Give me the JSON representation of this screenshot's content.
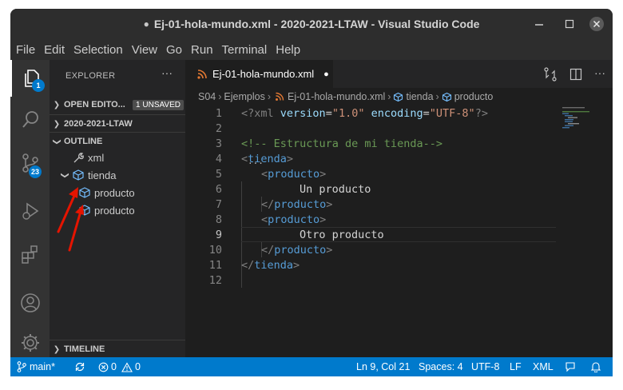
{
  "titlebar": {
    "title": "Ej-01-hola-mundo.xml - 2020-2021-LTAW - Visual Studio Code",
    "modified_dot": "●"
  },
  "menu": [
    "File",
    "Edit",
    "Selection",
    "View",
    "Go",
    "Run",
    "Terminal",
    "Help"
  ],
  "activity": {
    "explorer_badge": "1",
    "scm_badge": "23"
  },
  "sidebar": {
    "title": "EXPLORER",
    "more": "···",
    "open_editors": {
      "label": "OPEN EDITO...",
      "badge": "1 UNSAVED"
    },
    "folder": "2020-2021-LTAW",
    "outline": "OUTLINE",
    "outline_items": [
      "xml",
      "tienda",
      "producto",
      "producto"
    ],
    "timeline": "TIMELINE"
  },
  "editor": {
    "tab_label": "Ej-01-hola-mundo.xml",
    "tab_dirty": "●",
    "breadcrumb": [
      "S04",
      "Ejemplos",
      "Ej-01-hola-mundo.xml",
      "tienda",
      "producto"
    ]
  },
  "code": {
    "line_numbers": [
      "1",
      "2",
      "3",
      "4",
      "5",
      "6",
      "7",
      "8",
      "9",
      "10",
      "11",
      "12"
    ],
    "current_line": "9",
    "l1": {
      "a": "<?xml ",
      "b": "version",
      "c": "=",
      "d": "\"1.0\"",
      "e": " ",
      "f": "encoding",
      "g": "=",
      "h": "\"UTF-8\"",
      "i": "?>"
    },
    "l3": "<!-- Estructura de mi tienda-->",
    "l4": {
      "open": "<",
      "name": "tienda",
      "close": ">"
    },
    "l5": {
      "open": "<",
      "name": "producto",
      "close": ">"
    },
    "l6": "Un producto",
    "l7": {
      "open": "</",
      "name": "producto",
      "close": ">"
    },
    "l8": {
      "open": "<",
      "name": "producto",
      "close": ">"
    },
    "l9": "Otro producto",
    "l10": {
      "open": "</",
      "name": "producto",
      "close": ">"
    },
    "l11": {
      "open": "</",
      "name": "tienda",
      "close": ">"
    },
    "ellipsis": "..."
  },
  "status": {
    "branch": "main*",
    "errors": "0",
    "warnings": "0",
    "position": "Ln 9, Col 21",
    "spaces": "Spaces: 4",
    "encoding": "UTF-8",
    "eol": "LF",
    "language": "XML"
  },
  "colors": {
    "accent": "#007acc",
    "tag": "#569cd6",
    "tag_bracket": "#808080",
    "attr": "#9cdcfe",
    "string": "#ce9178",
    "comment": "#6a9955",
    "arrow": "#e51400"
  }
}
